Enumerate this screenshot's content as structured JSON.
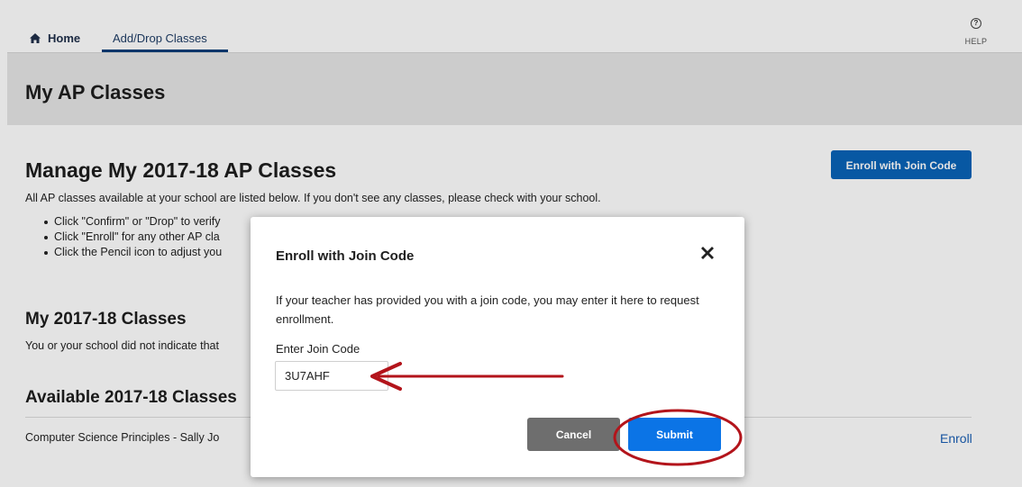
{
  "nav": {
    "home_label": "Home",
    "add_drop_label": "Add/Drop Classes",
    "help_label": "HELP"
  },
  "header": {
    "title": "My AP Classes"
  },
  "main": {
    "manage_heading": "Manage My 2017-18 AP Classes",
    "enroll_join_button": "Enroll with Join Code",
    "manage_description": "All AP classes available at your school are listed below. If you don't see any classes, please check with your school.",
    "instructions": [
      "Click \"Confirm\" or \"Drop\" to verify",
      "Click \"Enroll\" for any other AP cla",
      "Click the Pencil icon to adjust you"
    ],
    "my_classes_heading": "My 2017-18 Classes",
    "my_classes_note": "You or your school did not indicate that",
    "available_heading": "Available 2017-18 Classes",
    "available_rows": [
      {
        "name": "Computer Science Principles - Sally Jo",
        "action": "Enroll"
      }
    ]
  },
  "modal": {
    "title": "Enroll with Join Code",
    "body": "If your teacher has provided you with a join code, you may enter it here to request enrollment.",
    "join_code_label": "Enter Join Code",
    "join_code_value": "3U7AHF",
    "cancel_label": "Cancel",
    "submit_label": "Submit"
  },
  "colors": {
    "primary_button": "#0a63b8",
    "submit_button": "#0b74e6",
    "cancel_button": "#6e6e6e",
    "annotation": "#b3141b",
    "title_band": "#e6e6e6"
  },
  "icons": {
    "home": "home-icon",
    "help": "help-icon",
    "close": "close-icon"
  }
}
